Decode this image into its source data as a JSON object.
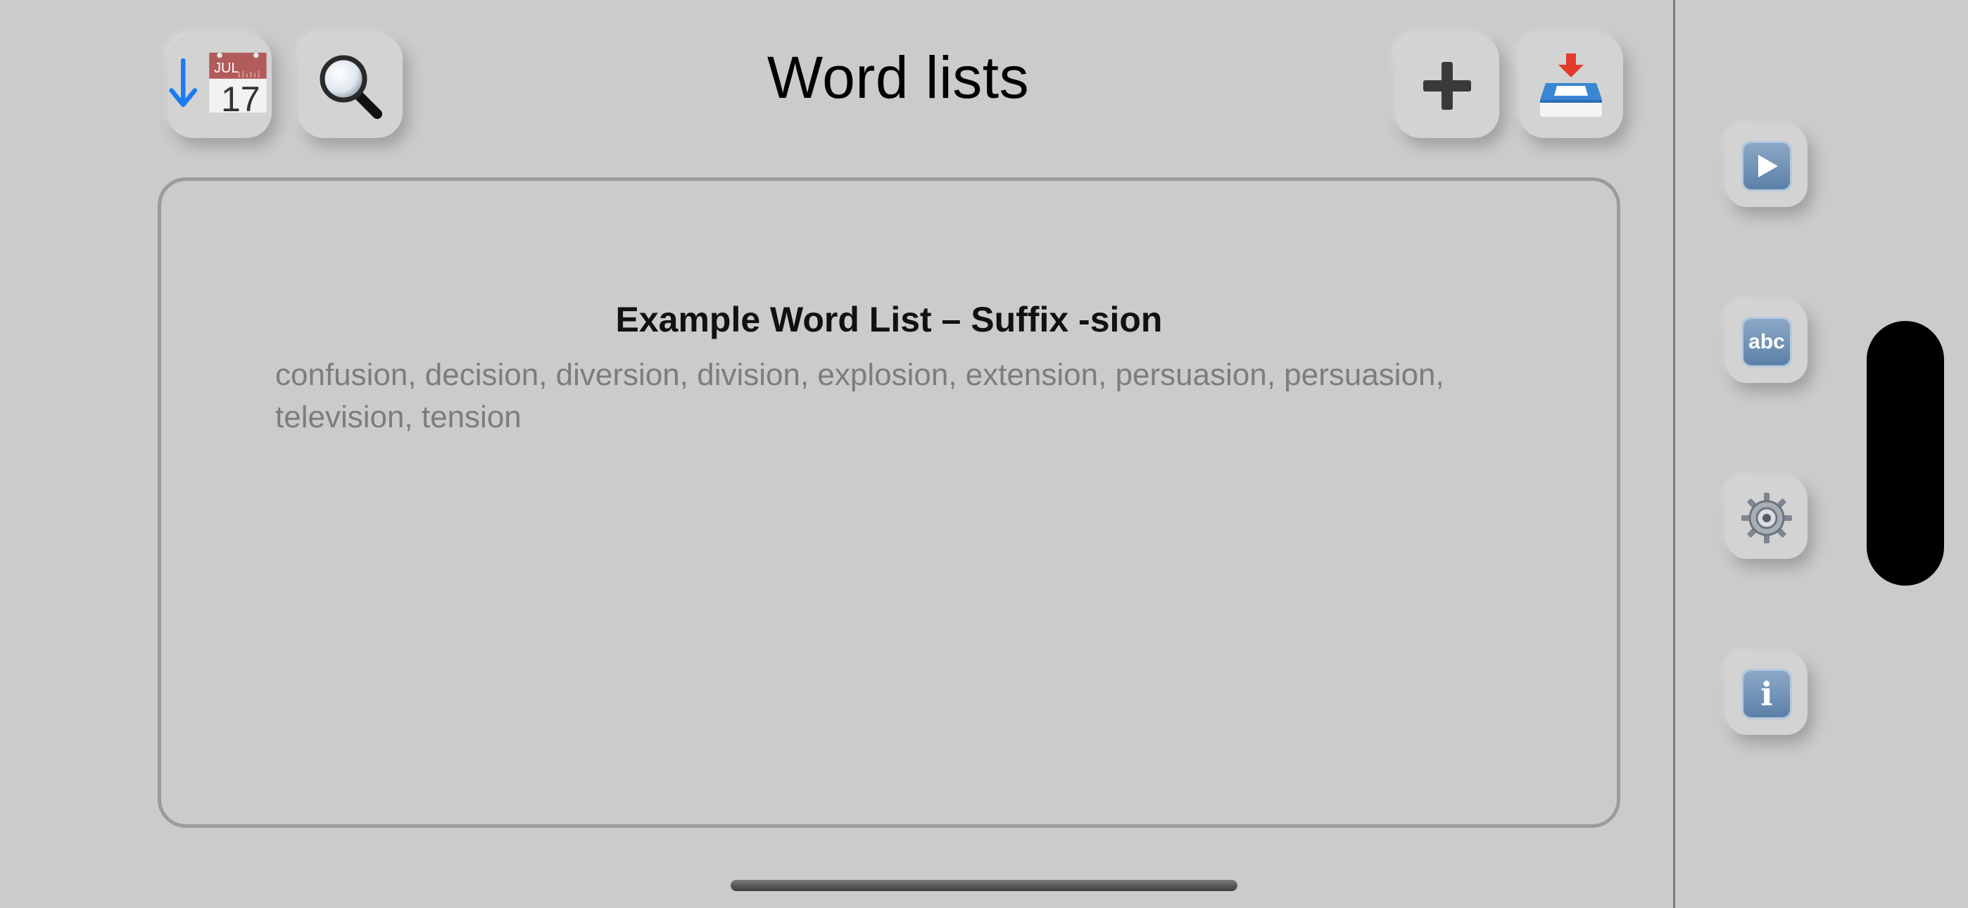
{
  "header": {
    "title": "Word lists"
  },
  "toolbar_left": {
    "sort_icon": "arrow-down-calendar-icon",
    "calendar_month": "JUL",
    "calendar_day": "17",
    "search_icon": "magnifier-icon"
  },
  "toolbar_right": {
    "add_icon": "plus-icon",
    "import_icon": "inbox-tray-icon"
  },
  "word_list": {
    "title": "Example Word List – Suffix -sion",
    "words": "confusion, decision, diversion, division, explosion, extension, persuasion, persuasion, television, tension"
  },
  "sidebar": {
    "items": [
      {
        "icon": "play-icon"
      },
      {
        "icon": "abc-icon",
        "label": "abc"
      },
      {
        "icon": "gear-icon"
      },
      {
        "icon": "info-icon",
        "label": "i"
      }
    ]
  },
  "colors": {
    "background": "#cbcbcb",
    "tile": "#d3d3d3",
    "card_border": "#9b9b9b",
    "words_text": "#7d7d7d",
    "accent_blue": "#1a7cf0",
    "calendar_red": "#b25b5b"
  }
}
